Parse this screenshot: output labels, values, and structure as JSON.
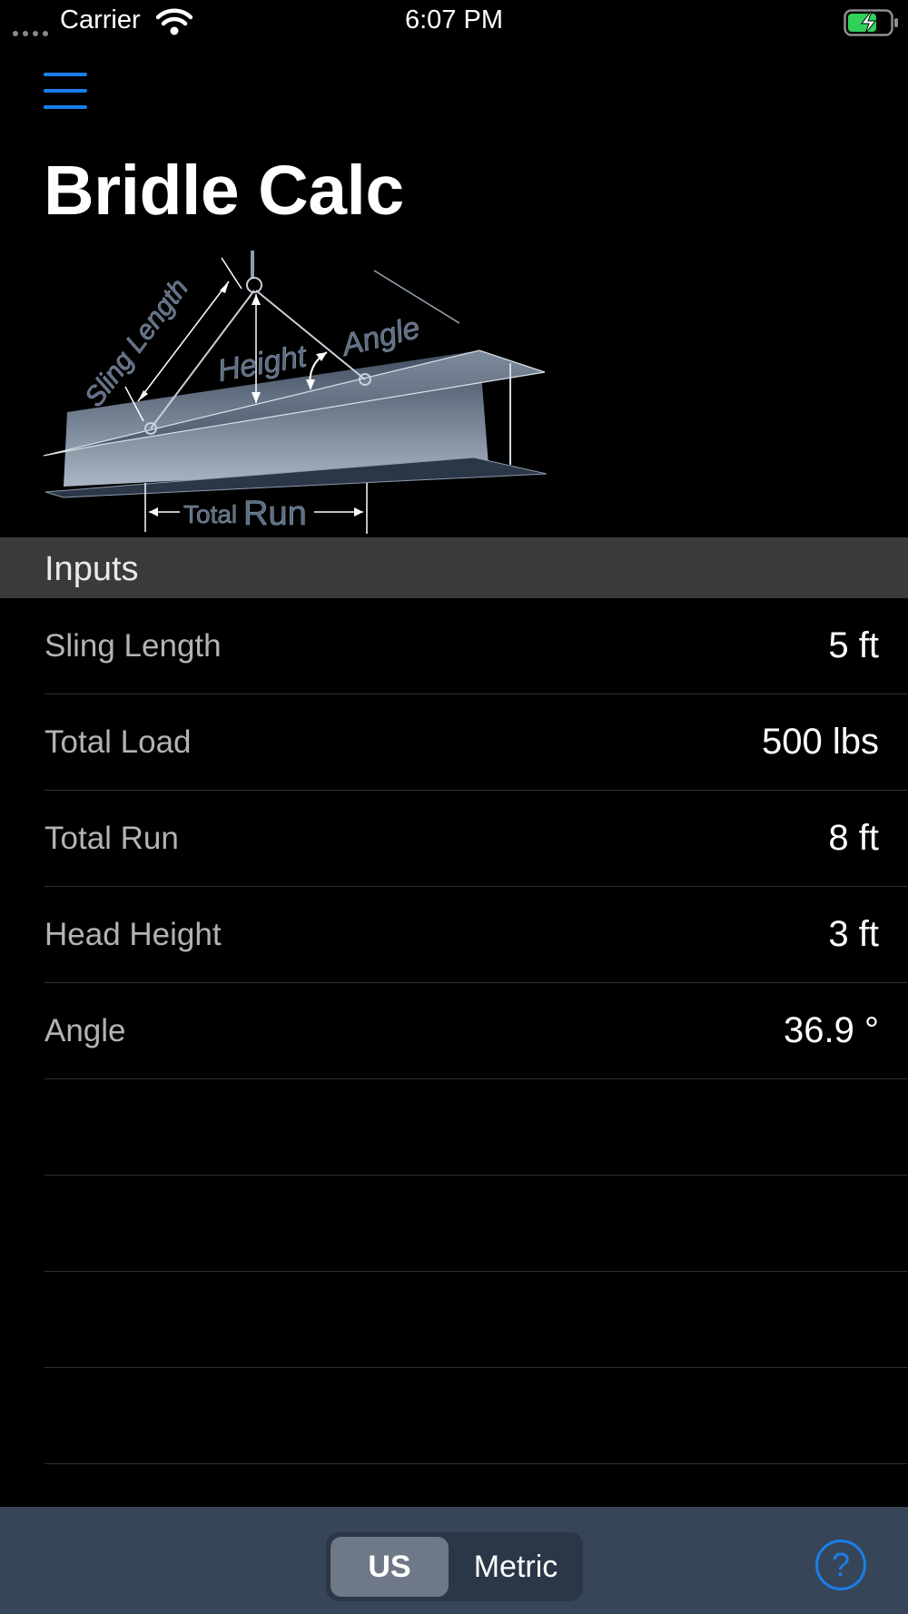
{
  "status_bar": {
    "carrier": "Carrier",
    "time": "6:07 PM",
    "battery_color": "#30d158"
  },
  "header": {
    "menu_icon": "hamburger-menu-icon",
    "title": "Bridle Calc"
  },
  "diagram": {
    "labels": {
      "sling_length": "Sling Length",
      "height": "Height",
      "angle": "Angle",
      "total": "Total",
      "run": "Run"
    }
  },
  "inputs": {
    "header": "Inputs",
    "rows": [
      {
        "label": "Sling Length",
        "value": "5 ft"
      },
      {
        "label": "Total Load",
        "value": "500 lbs"
      },
      {
        "label": "Total Run",
        "value": "8 ft"
      },
      {
        "label": "Head Height",
        "value": "3 ft"
      },
      {
        "label": "Angle",
        "value": "36.9 °"
      }
    ],
    "empty_rows": 4
  },
  "bottom_bar": {
    "units": {
      "options": [
        "US",
        "Metric"
      ],
      "selected": "US"
    },
    "help_label": "?",
    "accent_color": "#1a7fe8"
  }
}
